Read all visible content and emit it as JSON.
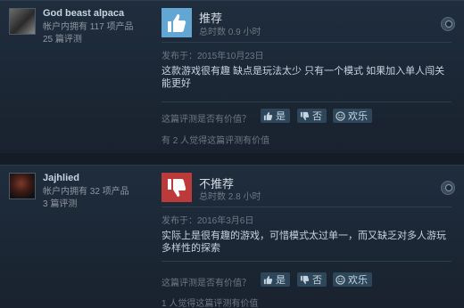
{
  "reviews": [
    {
      "author": {
        "name": "God beast alpaca",
        "products_owned": "帐户内拥有 117 项产品",
        "reviews_count": "25 篇评测"
      },
      "verdict": {
        "title": "推荐",
        "hours": "总时数 0.9 小时",
        "type": "positive",
        "color": "#62a6d4"
      },
      "posted": "发布于：2015年10月23日",
      "text": "这款游戏很有趣 缺点是玩法太少 只有一个模式 如果加入单人闯关能更好",
      "helpful_question": "这篇评测是否有价值？",
      "buttons": {
        "yes": "是",
        "no": "否",
        "funny": "欢乐"
      },
      "helpful_count": "有 2 人觉得这篇评测有价值"
    },
    {
      "author": {
        "name": "Jajhlied",
        "products_owned": "帐户内拥有 32 项产品",
        "reviews_count": "3 篇评测"
      },
      "verdict": {
        "title": "不推荐",
        "hours": "总时数 2.8 小时",
        "type": "negative",
        "color": "#bd3a3a"
      },
      "posted": "发布于：2016年3月6日",
      "text": "实际上是很有趣的游戏，可惜模式太过单一，而又缺乏对多人游玩多样性的探索",
      "helpful_question": "这篇评测是否有价值？",
      "buttons": {
        "yes": "是",
        "no": "否",
        "funny": "欢乐"
      },
      "helpful_count": "1 人觉得这篇评测有价值"
    }
  ],
  "icons": {
    "thumbs_up": "thumbs-up-icon",
    "thumbs_down": "thumbs-down-icon",
    "funny": "smiley-icon",
    "platform": "steam-icon"
  }
}
